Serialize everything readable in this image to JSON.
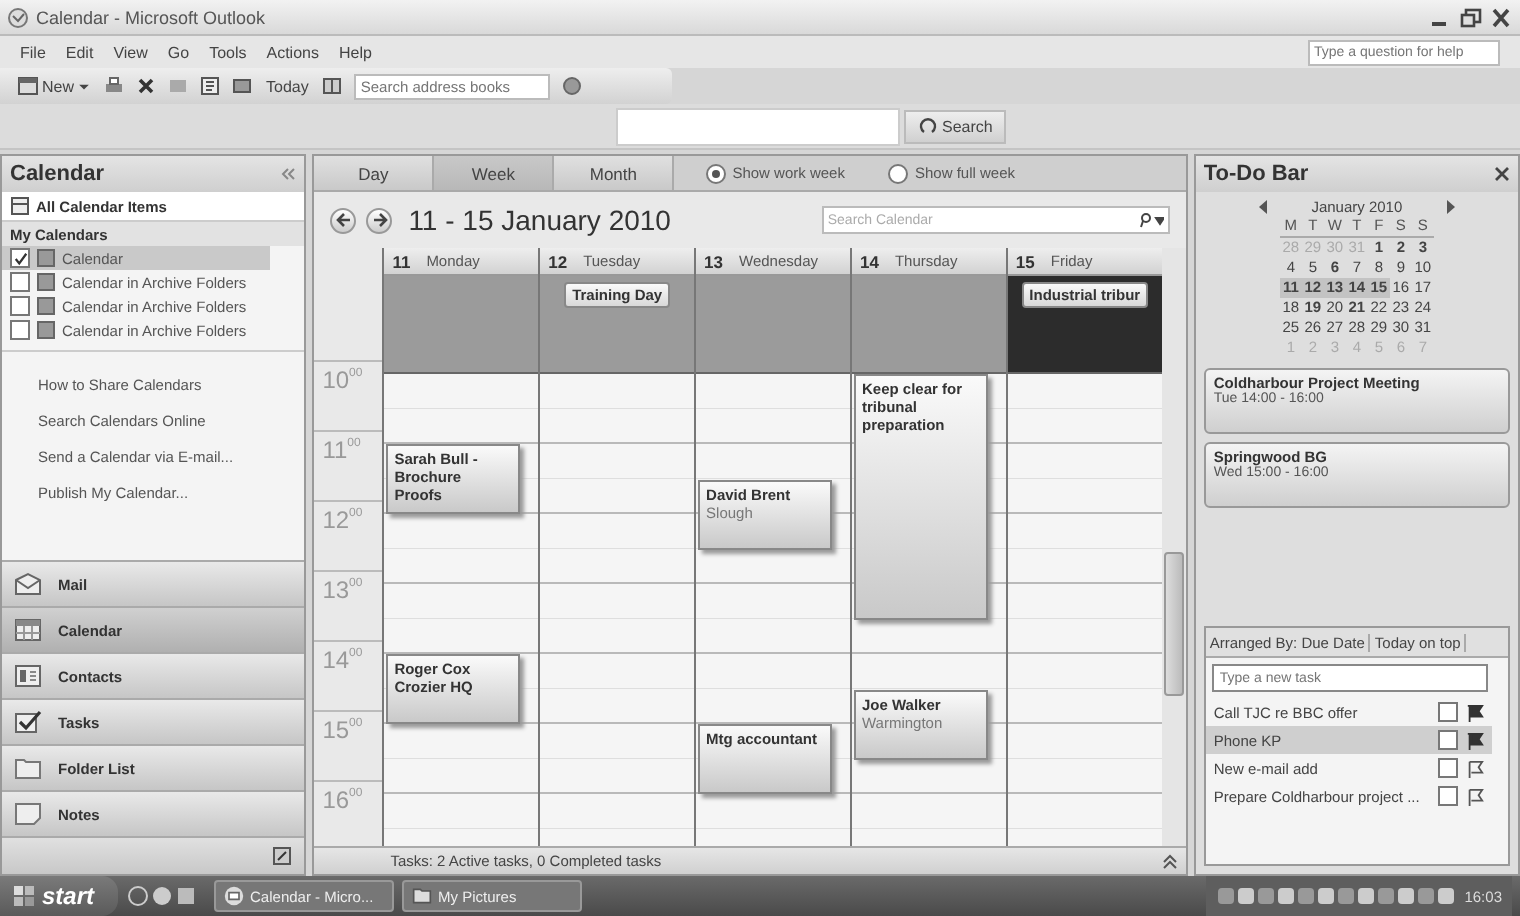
{
  "window": {
    "title": "Calendar - Microsoft Outlook"
  },
  "menu": [
    "File",
    "Edit",
    "View",
    "Go",
    "Tools",
    "Actions",
    "Help"
  ],
  "help_box": {
    "placeholder": "Type a question for help"
  },
  "toolbar": {
    "new": "New",
    "today": "Today",
    "address_search": {
      "placeholder": "Search address books"
    }
  },
  "search_row": {
    "button": "Search"
  },
  "nav_pane": {
    "title": "Calendar",
    "filter": "All Calendar Items",
    "group": "My Calendars",
    "calendars": [
      {
        "label": "Calendar",
        "checked": true,
        "selected": true
      },
      {
        "label": "Calendar in Archive Folders",
        "checked": false,
        "selected": false
      },
      {
        "label": "Calendar in Archive Folders",
        "checked": false,
        "selected": false
      },
      {
        "label": "Calendar in Archive Folders",
        "checked": false,
        "selected": false
      }
    ],
    "links": [
      "How to Share Calendars",
      "Search Calendars Online",
      "Send a Calendar via E-mail...",
      "Publish My Calendar..."
    ],
    "sections": [
      {
        "label": "Mail",
        "kind": "mail",
        "selected": false
      },
      {
        "label": "Calendar",
        "kind": "calendar",
        "selected": true
      },
      {
        "label": "Contacts",
        "kind": "contacts",
        "selected": false
      },
      {
        "label": "Tasks",
        "kind": "tasks",
        "selected": false
      },
      {
        "label": "Folder List",
        "kind": "folder",
        "selected": false
      },
      {
        "label": "Notes",
        "kind": "notes",
        "selected": false
      }
    ]
  },
  "calendar": {
    "views": [
      {
        "label": "Day",
        "selected": false
      },
      {
        "label": "Week",
        "selected": true
      },
      {
        "label": "Month",
        "selected": false
      }
    ],
    "week_options": [
      {
        "label": "Show work week",
        "selected": true
      },
      {
        "label": "Show full week",
        "selected": false
      }
    ],
    "range": "11 - 15 January 2010",
    "search": {
      "placeholder": "Search Calendar"
    },
    "days": [
      {
        "number": "11",
        "name": "Monday",
        "selected": false,
        "slots": [
          {
            "kind": "free"
          },
          {
            "kind": "free"
          },
          {
            "kind": "start",
            "title": "Sarah Bull - Brochure Proofs"
          },
          {
            "kind": "cont"
          },
          {
            "kind": "free"
          },
          {
            "kind": "free"
          },
          {
            "kind": "free"
          },
          {
            "kind": "free"
          },
          {
            "kind": "start",
            "title": "Roger Cox Crozier HQ"
          },
          {
            "kind": "cont"
          }
        ]
      },
      {
        "number": "12",
        "name": "Tuesday",
        "selected": false,
        "all_day": "Training Day"
      },
      {
        "number": "13",
        "name": "Wednesday",
        "selected": false,
        "slots": [
          {
            "kind": "free"
          },
          {
            "kind": "free"
          },
          {
            "kind": "free"
          },
          {
            "kind": "start",
            "title": "David Brent",
            "location": "Slough"
          },
          {
            "kind": "cont"
          },
          {
            "kind": "free"
          },
          {
            "kind": "free"
          },
          {
            "kind": "free"
          },
          {
            "kind": "free"
          },
          {
            "kind": "free"
          },
          {
            "kind": "start",
            "title": "Mtg accountant"
          },
          {
            "kind": "cont"
          }
        ]
      },
      {
        "number": "14",
        "name": "Thursday",
        "selected": false,
        "slots": [
          {
            "kind": "start",
            "title": "Keep clear for tribunal preparation"
          },
          {
            "kind": "cont"
          },
          {
            "kind": "cont"
          },
          {
            "kind": "cont"
          },
          {
            "kind": "cont"
          },
          {
            "kind": "cont"
          },
          {
            "kind": "cont"
          },
          {
            "kind": "free"
          },
          {
            "kind": "free"
          },
          {
            "kind": "start",
            "title": "Joe Walker",
            "location": "Warmington"
          },
          {
            "kind": "cont"
          }
        ]
      },
      {
        "number": "15",
        "name": "Friday",
        "selected": true,
        "all_day": "Industrial tribur"
      }
    ],
    "hours": [
      {
        "hour": "10",
        "minutes": "00"
      },
      {
        "hour": "11",
        "minutes": "00"
      },
      {
        "hour": "12",
        "minutes": "00"
      },
      {
        "hour": "13",
        "minutes": "00"
      },
      {
        "hour": "14",
        "minutes": "00"
      },
      {
        "hour": "15",
        "minutes": "00"
      },
      {
        "hour": "16",
        "minutes": "00"
      }
    ],
    "status": "Tasks: 2 Active tasks, 0 Completed tasks"
  },
  "todo": {
    "title": "To-Do Bar",
    "month": "January 2010",
    "weekdays": [
      "M",
      "T",
      "W",
      "T",
      "F",
      "S",
      "S"
    ],
    "weeks": [
      [
        {
          "d": "28",
          "muted": true,
          "bold": false,
          "selected": false
        },
        {
          "d": "29",
          "muted": true,
          "bold": false,
          "selected": false
        },
        {
          "d": "30",
          "muted": true,
          "bold": false,
          "selected": false
        },
        {
          "d": "31",
          "muted": true,
          "bold": false,
          "selected": false
        },
        {
          "d": "1",
          "muted": false,
          "bold": true,
          "selected": false
        },
        {
          "d": "2",
          "muted": false,
          "bold": true,
          "selected": false
        },
        {
          "d": "3",
          "muted": false,
          "bold": true,
          "selected": false
        }
      ],
      [
        {
          "d": "4",
          "muted": false,
          "bold": false,
          "selected": false
        },
        {
          "d": "5",
          "muted": false,
          "bold": false,
          "selected": false
        },
        {
          "d": "6",
          "muted": false,
          "bold": true,
          "selected": false
        },
        {
          "d": "7",
          "muted": false,
          "bold": false,
          "selected": false
        },
        {
          "d": "8",
          "muted": false,
          "bold": false,
          "selected": false
        },
        {
          "d": "9",
          "muted": false,
          "bold": false,
          "selected": false
        },
        {
          "d": "10",
          "muted": false,
          "bold": false,
          "selected": false
        }
      ],
      [
        {
          "d": "11",
          "muted": false,
          "bold": true,
          "selected": true
        },
        {
          "d": "12",
          "muted": false,
          "bold": true,
          "selected": true
        },
        {
          "d": "13",
          "muted": false,
          "bold": true,
          "selected": true
        },
        {
          "d": "14",
          "muted": false,
          "bold": true,
          "selected": true
        },
        {
          "d": "15",
          "muted": false,
          "bold": true,
          "selected": true
        },
        {
          "d": "16",
          "muted": false,
          "bold": false,
          "selected": false
        },
        {
          "d": "17",
          "muted": false,
          "bold": false,
          "selected": false
        }
      ],
      [
        {
          "d": "18",
          "muted": false,
          "bold": false,
          "selected": false
        },
        {
          "d": "19",
          "muted": false,
          "bold": true,
          "selected": false
        },
        {
          "d": "20",
          "muted": false,
          "bold": false,
          "selected": false
        },
        {
          "d": "21",
          "muted": false,
          "bold": true,
          "selected": false
        },
        {
          "d": "22",
          "muted": false,
          "bold": false,
          "selected": false
        },
        {
          "d": "23",
          "muted": false,
          "bold": false,
          "selected": false
        },
        {
          "d": "24",
          "muted": false,
          "bold": false,
          "selected": false
        }
      ],
      [
        {
          "d": "25",
          "muted": false,
          "bold": false,
          "selected": false
        },
        {
          "d": "26",
          "muted": false,
          "bold": false,
          "selected": false
        },
        {
          "d": "27",
          "muted": false,
          "bold": false,
          "selected": false
        },
        {
          "d": "28",
          "muted": false,
          "bold": false,
          "selected": false
        },
        {
          "d": "29",
          "muted": false,
          "bold": false,
          "selected": false
        },
        {
          "d": "30",
          "muted": false,
          "bold": false,
          "selected": false
        },
        {
          "d": "31",
          "muted": false,
          "bold": false,
          "selected": false
        }
      ],
      [
        {
          "d": "1",
          "muted": true,
          "bold": false,
          "selected": false
        },
        {
          "d": "2",
          "muted": true,
          "bold": false,
          "selected": false
        },
        {
          "d": "3",
          "muted": true,
          "bold": false,
          "selected": false
        },
        {
          "d": "4",
          "muted": true,
          "bold": false,
          "selected": false
        },
        {
          "d": "5",
          "muted": true,
          "bold": false,
          "selected": false
        },
        {
          "d": "6",
          "muted": true,
          "bold": false,
          "selected": false
        },
        {
          "d": "7",
          "muted": true,
          "bold": false,
          "selected": false
        }
      ]
    ],
    "appointments": [
      {
        "title": "Coldharbour Project Meeting",
        "time": "Tue 14:00 - 16:00"
      },
      {
        "title": "Springwood BG",
        "time": "Wed 15:00 - 16:00"
      }
    ],
    "tasks": {
      "arranged": "Arranged By: Due Date",
      "order": "Today on top",
      "placeholder": "Type a new task",
      "items": [
        {
          "subject": "Call TJC re BBC offer",
          "selected": false,
          "checked": false,
          "kind": "filled"
        },
        {
          "subject": "Phone  KP",
          "selected": true,
          "checked": false,
          "kind": "filled"
        },
        {
          "subject": "New e-mail add",
          "selected": false,
          "checked": false,
          "kind": "outline"
        },
        {
          "subject": "Prepare Coldharbour project ...",
          "selected": false,
          "checked": false,
          "kind": "outline"
        }
      ]
    }
  },
  "taskbar": {
    "start": "start",
    "buttons": [
      {
        "label": "Calendar - Micro...",
        "kind": "outlook"
      },
      {
        "label": "My Pictures",
        "kind": "folder"
      }
    ],
    "clock": "16:03"
  }
}
